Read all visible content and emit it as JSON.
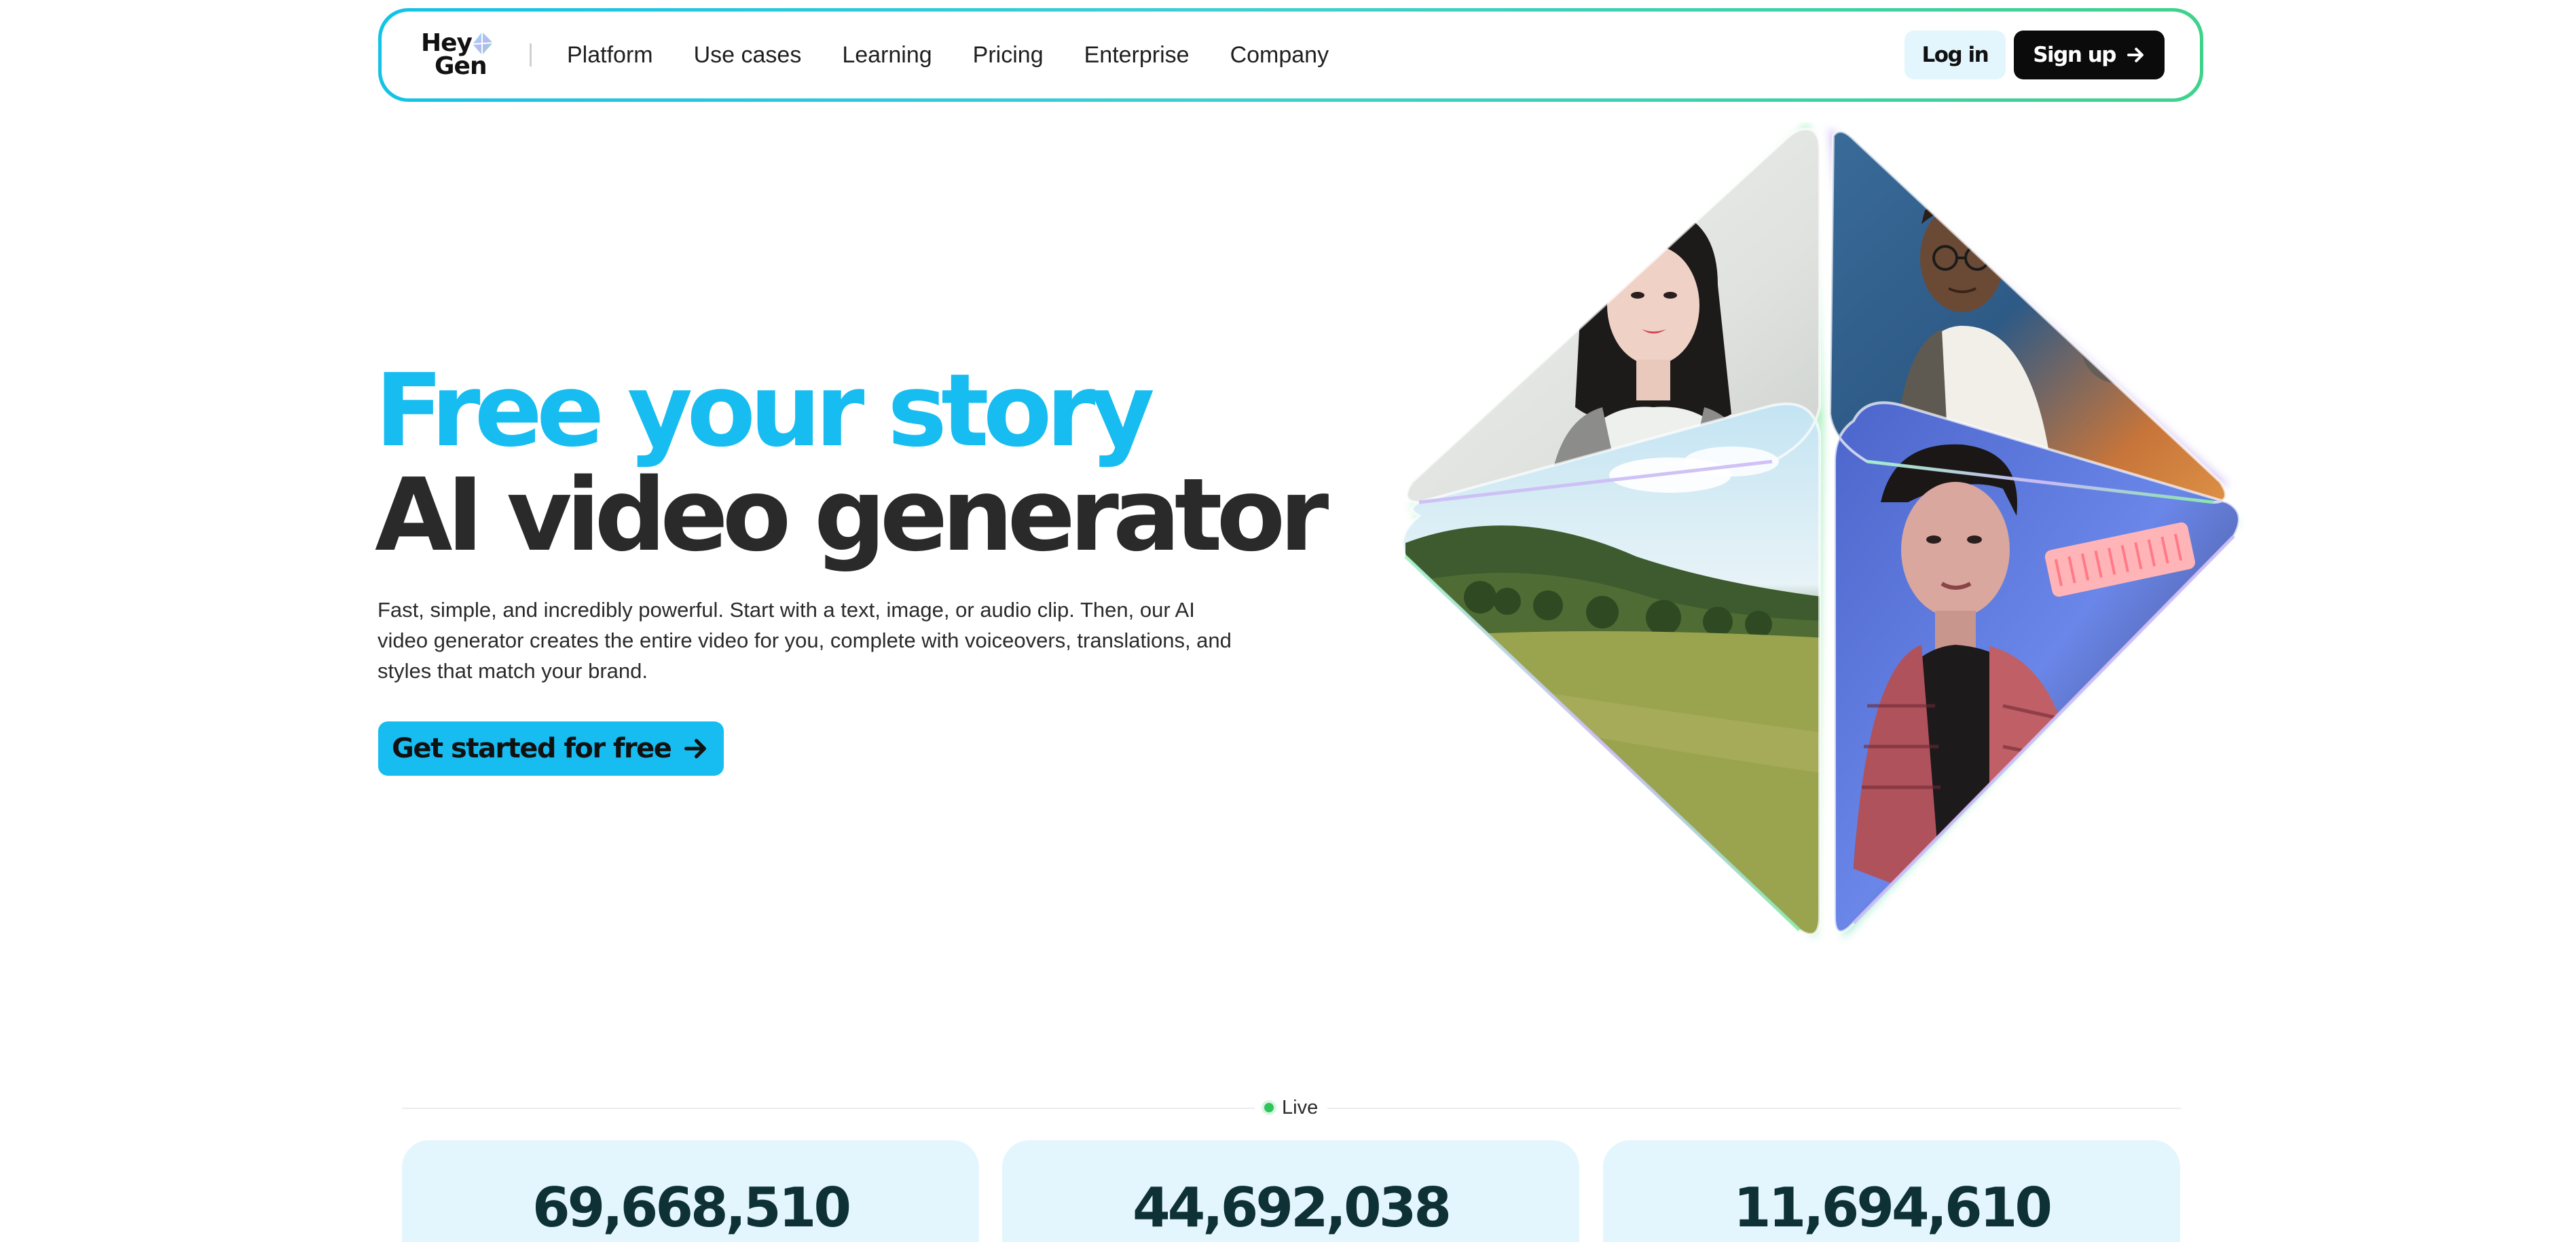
{
  "brand": {
    "logo_line1": "Hey",
    "logo_line2": "Gen",
    "accent_color": "#17bdf0",
    "dark_color": "#2a2a2a",
    "nav_border_gradient": [
      "#12c3e6",
      "#3dd38a"
    ]
  },
  "nav": {
    "links": [
      {
        "label": "Platform"
      },
      {
        "label": "Use cases"
      },
      {
        "label": "Learning"
      },
      {
        "label": "Pricing"
      },
      {
        "label": "Enterprise"
      },
      {
        "label": "Company"
      }
    ],
    "login_label": "Log in",
    "signup_label": "Sign up",
    "signup_icon": "arrow-right-icon"
  },
  "hero": {
    "title_line1": "Free your story",
    "title_line2": "AI video generator",
    "description": "Fast, simple, and incredibly powerful. Start with a text, image, or audio clip. Then, our AI video generator creates the entire video for you, complete with voiceovers, translations, and styles that match your brand.",
    "cta_label": "Get started for free",
    "cta_icon": "arrow-right-icon",
    "visual_tiles": [
      "woman-portrait",
      "man-with-glasses-portrait",
      "meadow-landscape",
      "man-portrait"
    ]
  },
  "live": {
    "label": "Live",
    "indicator_color": "#2fc55a"
  },
  "stats": [
    {
      "value": "69,668,510"
    },
    {
      "value": "44,692,038"
    },
    {
      "value": "11,694,610"
    }
  ]
}
